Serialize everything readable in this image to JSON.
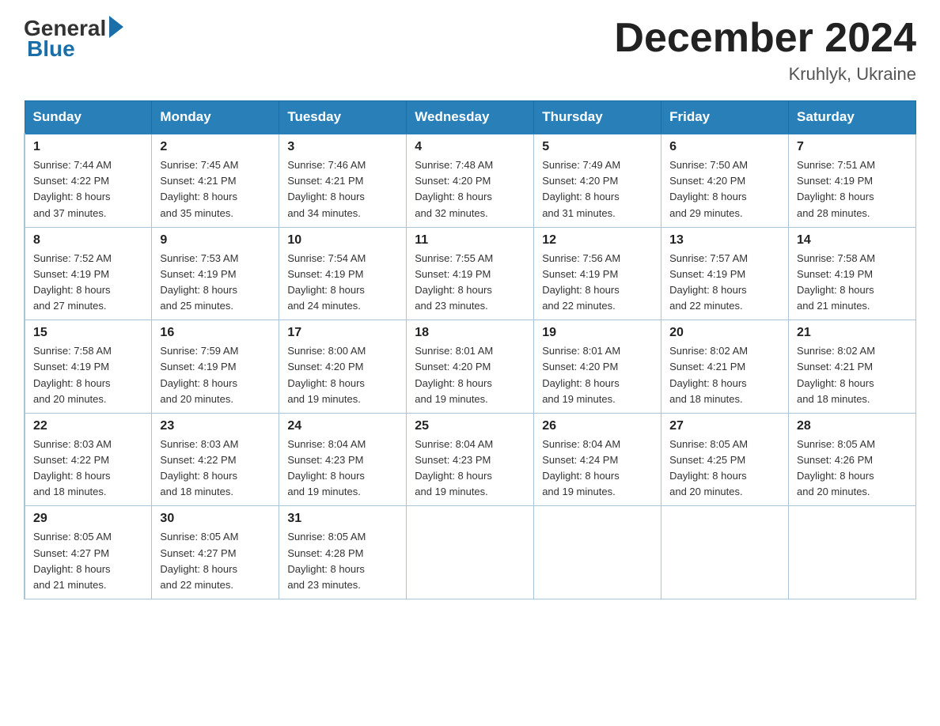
{
  "logo": {
    "general": "General",
    "blue": "Blue"
  },
  "title": {
    "month_year": "December 2024",
    "location": "Kruhlyk, Ukraine"
  },
  "weekdays": [
    "Sunday",
    "Monday",
    "Tuesday",
    "Wednesday",
    "Thursday",
    "Friday",
    "Saturday"
  ],
  "weeks": [
    [
      {
        "day": "1",
        "sunrise": "7:44 AM",
        "sunset": "4:22 PM",
        "daylight": "8 hours and 37 minutes."
      },
      {
        "day": "2",
        "sunrise": "7:45 AM",
        "sunset": "4:21 PM",
        "daylight": "8 hours and 35 minutes."
      },
      {
        "day": "3",
        "sunrise": "7:46 AM",
        "sunset": "4:21 PM",
        "daylight": "8 hours and 34 minutes."
      },
      {
        "day": "4",
        "sunrise": "7:48 AM",
        "sunset": "4:20 PM",
        "daylight": "8 hours and 32 minutes."
      },
      {
        "day": "5",
        "sunrise": "7:49 AM",
        "sunset": "4:20 PM",
        "daylight": "8 hours and 31 minutes."
      },
      {
        "day": "6",
        "sunrise": "7:50 AM",
        "sunset": "4:20 PM",
        "daylight": "8 hours and 29 minutes."
      },
      {
        "day": "7",
        "sunrise": "7:51 AM",
        "sunset": "4:19 PM",
        "daylight": "8 hours and 28 minutes."
      }
    ],
    [
      {
        "day": "8",
        "sunrise": "7:52 AM",
        "sunset": "4:19 PM",
        "daylight": "8 hours and 27 minutes."
      },
      {
        "day": "9",
        "sunrise": "7:53 AM",
        "sunset": "4:19 PM",
        "daylight": "8 hours and 25 minutes."
      },
      {
        "day": "10",
        "sunrise": "7:54 AM",
        "sunset": "4:19 PM",
        "daylight": "8 hours and 24 minutes."
      },
      {
        "day": "11",
        "sunrise": "7:55 AM",
        "sunset": "4:19 PM",
        "daylight": "8 hours and 23 minutes."
      },
      {
        "day": "12",
        "sunrise": "7:56 AM",
        "sunset": "4:19 PM",
        "daylight": "8 hours and 22 minutes."
      },
      {
        "day": "13",
        "sunrise": "7:57 AM",
        "sunset": "4:19 PM",
        "daylight": "8 hours and 22 minutes."
      },
      {
        "day": "14",
        "sunrise": "7:58 AM",
        "sunset": "4:19 PM",
        "daylight": "8 hours and 21 minutes."
      }
    ],
    [
      {
        "day": "15",
        "sunrise": "7:58 AM",
        "sunset": "4:19 PM",
        "daylight": "8 hours and 20 minutes."
      },
      {
        "day": "16",
        "sunrise": "7:59 AM",
        "sunset": "4:19 PM",
        "daylight": "8 hours and 20 minutes."
      },
      {
        "day": "17",
        "sunrise": "8:00 AM",
        "sunset": "4:20 PM",
        "daylight": "8 hours and 19 minutes."
      },
      {
        "day": "18",
        "sunrise": "8:01 AM",
        "sunset": "4:20 PM",
        "daylight": "8 hours and 19 minutes."
      },
      {
        "day": "19",
        "sunrise": "8:01 AM",
        "sunset": "4:20 PM",
        "daylight": "8 hours and 19 minutes."
      },
      {
        "day": "20",
        "sunrise": "8:02 AM",
        "sunset": "4:21 PM",
        "daylight": "8 hours and 18 minutes."
      },
      {
        "day": "21",
        "sunrise": "8:02 AM",
        "sunset": "4:21 PM",
        "daylight": "8 hours and 18 minutes."
      }
    ],
    [
      {
        "day": "22",
        "sunrise": "8:03 AM",
        "sunset": "4:22 PM",
        "daylight": "8 hours and 18 minutes."
      },
      {
        "day": "23",
        "sunrise": "8:03 AM",
        "sunset": "4:22 PM",
        "daylight": "8 hours and 18 minutes."
      },
      {
        "day": "24",
        "sunrise": "8:04 AM",
        "sunset": "4:23 PM",
        "daylight": "8 hours and 19 minutes."
      },
      {
        "day": "25",
        "sunrise": "8:04 AM",
        "sunset": "4:23 PM",
        "daylight": "8 hours and 19 minutes."
      },
      {
        "day": "26",
        "sunrise": "8:04 AM",
        "sunset": "4:24 PM",
        "daylight": "8 hours and 19 minutes."
      },
      {
        "day": "27",
        "sunrise": "8:05 AM",
        "sunset": "4:25 PM",
        "daylight": "8 hours and 20 minutes."
      },
      {
        "day": "28",
        "sunrise": "8:05 AM",
        "sunset": "4:26 PM",
        "daylight": "8 hours and 20 minutes."
      }
    ],
    [
      {
        "day": "29",
        "sunrise": "8:05 AM",
        "sunset": "4:27 PM",
        "daylight": "8 hours and 21 minutes."
      },
      {
        "day": "30",
        "sunrise": "8:05 AM",
        "sunset": "4:27 PM",
        "daylight": "8 hours and 22 minutes."
      },
      {
        "day": "31",
        "sunrise": "8:05 AM",
        "sunset": "4:28 PM",
        "daylight": "8 hours and 23 minutes."
      },
      null,
      null,
      null,
      null
    ]
  ],
  "labels": {
    "sunrise": "Sunrise:",
    "sunset": "Sunset:",
    "daylight": "Daylight:"
  }
}
